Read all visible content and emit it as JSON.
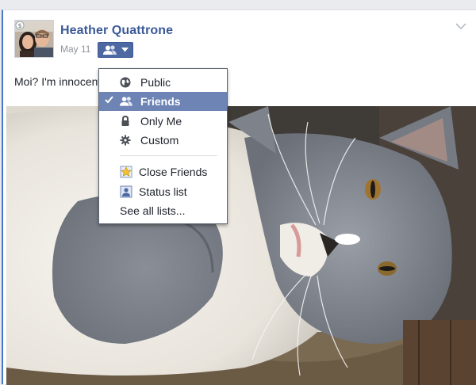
{
  "post": {
    "author": "Heather Quattrone",
    "date": "May 11",
    "text": "Moi? I'm innocent!"
  },
  "audience_menu": {
    "items": [
      {
        "label": "Public",
        "icon": "globe-icon",
        "selected": false
      },
      {
        "label": "Friends",
        "icon": "friends-icon",
        "selected": true
      },
      {
        "label": "Only Me",
        "icon": "lock-icon",
        "selected": false
      },
      {
        "label": "Custom",
        "icon": "gear-icon",
        "selected": false
      }
    ],
    "lists": [
      {
        "label": "Close Friends",
        "icon": "star-list-icon"
      },
      {
        "label": "Status list",
        "icon": "person-list-icon"
      }
    ],
    "see_all": "See all lists..."
  },
  "colors": {
    "author": "#3b5998",
    "selected_row": "#6d84b4",
    "audience_button": "#4e69a2"
  }
}
